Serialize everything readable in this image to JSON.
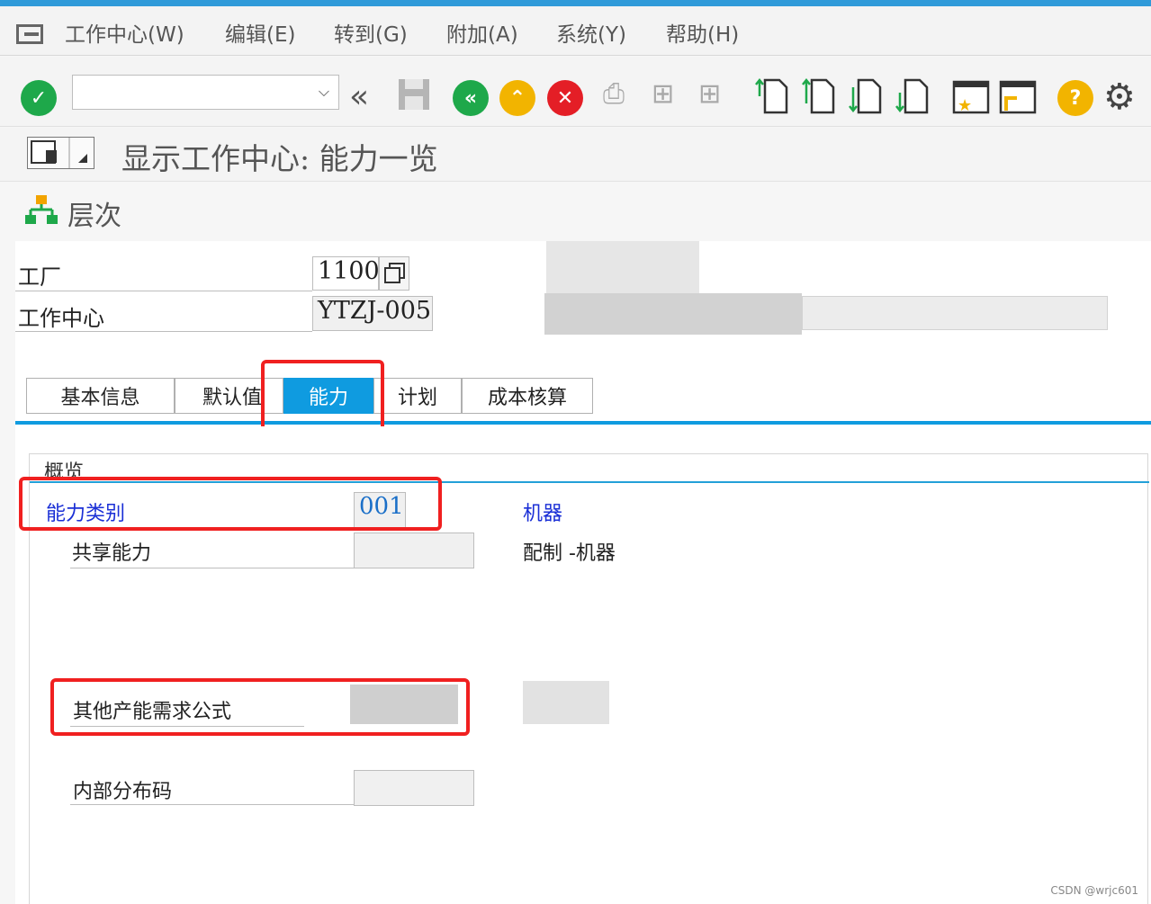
{
  "menubar": {
    "items": [
      "工作中心(W)",
      "编辑(E)",
      "转到(G)",
      "附加(A)",
      "系统(Y)",
      "帮助(H)"
    ]
  },
  "toolbar": {
    "command_value": "",
    "icons": [
      "enter-icon",
      "back-double-icon",
      "save-icon",
      "back-icon",
      "exit-icon",
      "cancel-icon",
      "print-icon",
      "find-icon",
      "find-next-icon",
      "first-page-icon",
      "prev-page-icon",
      "next-page-icon",
      "last-page-icon",
      "new-session-icon",
      "shortcut-icon",
      "help-icon",
      "settings-icon"
    ]
  },
  "title": "显示工作中心: 能力一览",
  "hierarchy": {
    "label": "层次"
  },
  "fields": {
    "plant_label": "工厂",
    "plant_value": "1100",
    "workcenter_label": "工作中心",
    "workcenter_value": "YTZJ-005"
  },
  "tabs": [
    "基本信息",
    "默认值",
    "能力",
    "计划",
    "成本核算"
  ],
  "active_tab": "能力",
  "overview": {
    "title": "概览",
    "capacity_category_label": "能力类别",
    "capacity_category_value": "001",
    "capacity_category_desc": "机器",
    "shared_capacity_label": "共享能力",
    "shared_capacity_desc": "配制 -机器",
    "other_formula_label": "其他产能需求公式",
    "distribution_key_label": "内部分布码"
  },
  "watermark": "CSDN @wrjc601",
  "colors": {
    "accent": "#0f9be0",
    "highlight": "#f02020",
    "link": "#1a2fd6"
  }
}
